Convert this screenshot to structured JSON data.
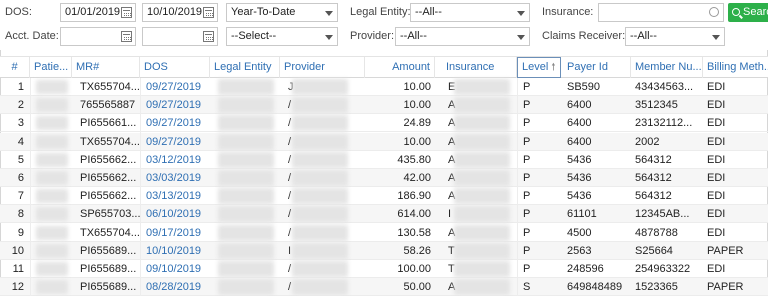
{
  "filters": {
    "dos_label": "DOS:",
    "dos_from": "01/01/2019",
    "dos_to": "10/10/2019",
    "period": "Year-To-Date",
    "legal_entity_label": "Legal Entity:",
    "legal_entity_value": "--All--",
    "insurance_label": "Insurance:",
    "insurance_value": "",
    "search_label": "Search",
    "acct_date_label": "Acct. Date:",
    "acct_from": "",
    "acct_to": "",
    "acct_period": "--Select--",
    "provider_label": "Provider:",
    "provider_value": "--All--",
    "claims_receiver_label": "Claims Receiver:",
    "claims_receiver_value": "--All--"
  },
  "grid": {
    "columns": [
      "#",
      "Patie...",
      "MR#",
      "DOS",
      "Legal Entity",
      "Provider",
      "Amount",
      "Insurance",
      "Level",
      "Payer Id",
      "Member Nu...",
      "Billing Meth..."
    ],
    "sorted_column": "Level",
    "sort_direction": "ascending",
    "rows": [
      {
        "n": "1",
        "mr": "TX655704...",
        "dos": "09/27/2019",
        "prov": "J",
        "amount": "10.00",
        "ins": "E",
        "level": "P",
        "payer": "SB590",
        "member": "43434563...",
        "billing": "EDI"
      },
      {
        "n": "2",
        "mr": "765565887",
        "dos": "09/27/2019",
        "prov": "/",
        "amount": "10.00",
        "ins": "A",
        "level": "P",
        "payer": "6400",
        "member": "3512345",
        "billing": "EDI"
      },
      {
        "n": "3",
        "mr": "PI655661...",
        "dos": "09/27/2019",
        "prov": "/",
        "amount": "24.89",
        "ins": "A",
        "level": "P",
        "payer": "6400",
        "member": "23132112...",
        "billing": "EDI"
      },
      {
        "n": "4",
        "mr": "TX655704...",
        "dos": "09/27/2019",
        "prov": "/",
        "amount": "10.00",
        "ins": "A",
        "level": "P",
        "payer": "6400",
        "member": "2002",
        "billing": "EDI"
      },
      {
        "n": "5",
        "mr": "PI655662...",
        "dos": "03/12/2019",
        "prov": "/",
        "amount": "435.80",
        "ins": "A",
        "level": "P",
        "payer": "5436",
        "member": "564312",
        "billing": "EDI"
      },
      {
        "n": "6",
        "mr": "PI655662...",
        "dos": "03/03/2019",
        "prov": "/",
        "amount": "42.00",
        "ins": "A",
        "level": "P",
        "payer": "5436",
        "member": "564312",
        "billing": "EDI"
      },
      {
        "n": "7",
        "mr": "PI655662...",
        "dos": "03/13/2019",
        "prov": "/",
        "amount": "186.90",
        "ins": "A",
        "level": "P",
        "payer": "5436",
        "member": "564312",
        "billing": "EDI"
      },
      {
        "n": "8",
        "mr": "SP655703...",
        "dos": "06/10/2019",
        "prov": "/",
        "amount": "614.00",
        "ins": "I",
        "level": "P",
        "payer": "61101",
        "member": "12345AB...",
        "billing": "EDI"
      },
      {
        "n": "9",
        "mr": "TX655704...",
        "dos": "09/17/2019",
        "prov": "/",
        "amount": "130.58",
        "ins": "A",
        "level": "P",
        "payer": "4500",
        "member": "4878788",
        "billing": "EDI"
      },
      {
        "n": "10",
        "mr": "PI655689...",
        "dos": "10/10/2019",
        "prov": "I",
        "amount": "58.26",
        "ins": "T",
        "level": "P",
        "payer": "2563",
        "member": "S25664",
        "billing": "PAPER"
      },
      {
        "n": "11",
        "mr": "PI655689...",
        "dos": "09/10/2019",
        "prov": "/",
        "amount": "100.00",
        "ins": "T",
        "level": "P",
        "payer": "248596",
        "member": "254963322",
        "billing": "EDI"
      },
      {
        "n": "12",
        "mr": "PI655689...",
        "dos": "08/28/2019",
        "prov": "/",
        "amount": "50.00",
        "ins": "A",
        "level": "S",
        "payer": "649848489",
        "member": "1523365",
        "billing": "PAPER"
      }
    ]
  },
  "colors": {
    "accent": "#2f6fb3",
    "search_button": "#2db04a",
    "row_alt": "#f6f6f6"
  }
}
